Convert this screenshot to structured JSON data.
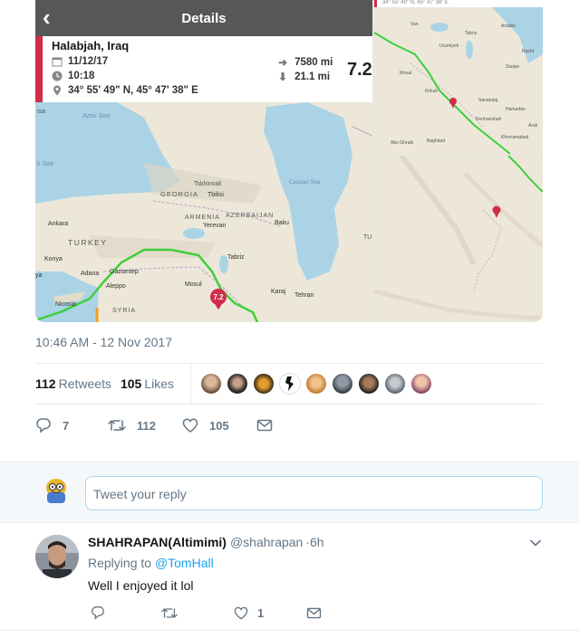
{
  "media": {
    "details_title": "Details",
    "place": "Halabjah, Iraq",
    "date": "11/12/17",
    "time": "10:18",
    "coords": "34° 55' 49\" N, 45° 47' 38\" E",
    "distance": "7580 mi",
    "depth": "21.1 mi",
    "magnitude": "7.2",
    "pin_label": "7.2",
    "corner_caption": "34° 55' 49\" N, 45° 47' 38\" E",
    "main_labels": {
      "azov": "Azov Sea",
      "blacksea": "k Sea",
      "caspian": "Caspian Sea",
      "georgia": "GEORGIA",
      "tskhinvali": "Tskhinvali",
      "tbilisi": "Tbilisi",
      "armenia": "ARMENIA",
      "yerevan": "Yerevan",
      "azerbaijan": "AZERBAIJAN",
      "baku": "Baku",
      "ankara": "Ankara",
      "turkey": "TURKEY",
      "konya": "Konya",
      "adana": "Adana",
      "gaziantep": "Gaziantep",
      "aleppo": "Aleppo",
      "tabriz": "Tabriz",
      "mosul": "Mosul",
      "karaj": "Karaj",
      "tehran": "Tehran",
      "nicosia": "Nicosia",
      "syria": "SYRIA",
      "isa": "isa",
      "ya": "ya",
      "tu": "TU"
    },
    "tr_labels": {
      "van": "Van",
      "tabriz": "Tabriz",
      "ardabil": "Ardabil",
      "rasht": "Rasht",
      "urumiyeh": "Urumiyeh",
      "zanjan": "Zanjan",
      "mosul": "Mosul",
      "kirkuk": "Kirkuk",
      "sanandaj": "Sanandaj",
      "hamadan": "Hamadan",
      "kermanshah": "Kermanshah",
      "arak": "Arak",
      "khorramabad": "Khorramabad",
      "abughraib": "Abu Ghraib",
      "baghdad": "Baghdad"
    }
  },
  "tweet": {
    "timestamp": "10:46 AM - 12 Nov 2017",
    "retweets_count": "112",
    "retweets_label": "Retweets",
    "likes_count": "105",
    "likes_label": "Likes",
    "actions": {
      "reply_count": "7",
      "retweet_count": "112",
      "like_count": "105"
    }
  },
  "reply_box": {
    "placeholder": "Tweet your reply"
  },
  "reply": {
    "name": "SHAHRAPAN(Altimimi)",
    "handle": "@shahrapan",
    "time": "·6h",
    "replying_prefix": "Replying to",
    "replying_to": "@TomHall",
    "text": "Well I enjoyed it lol",
    "like_count": "1"
  },
  "colors": {
    "accent": "#1da1f2",
    "pin": "#d12d49",
    "route": "#3ecf3a",
    "muted": "#657786"
  }
}
